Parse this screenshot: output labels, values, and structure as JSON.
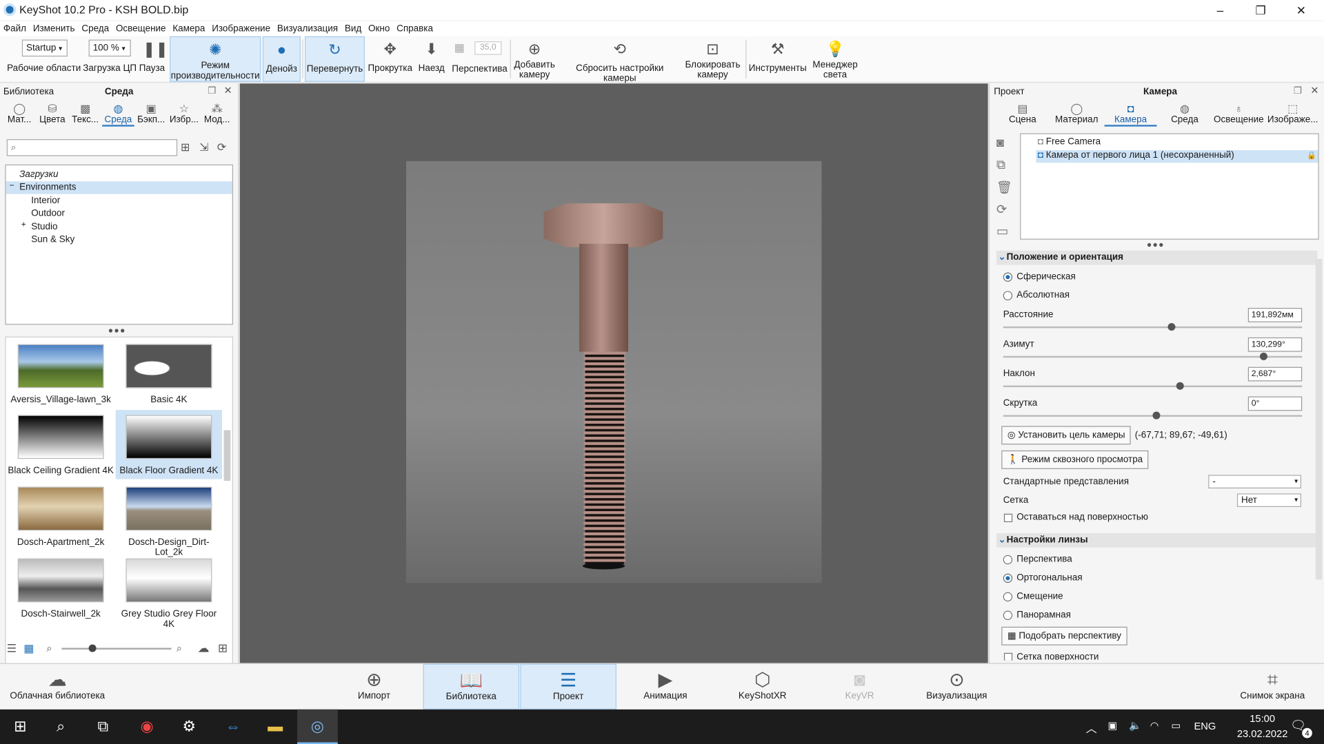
{
  "title": "KeyShot 10.2 Pro  - KSH BOLD.bip",
  "window_controls": {
    "min": "–",
    "max": "❐",
    "close": "✕"
  },
  "menu": [
    "Файл",
    "Изменить",
    "Среда",
    "Освещение",
    "Камера",
    "Изображение",
    "Визуализация",
    "Вид",
    "Окно",
    "Справка"
  ],
  "toolbar": {
    "workspace_value": "Startup",
    "workspace_label": "Рабочие области",
    "cpu_value": "100 %",
    "cpu_label": "Загрузка ЦП",
    "pause": "Пауза",
    "performance": "Режим производительности",
    "denoise": "Денойз",
    "tumble": "Перевернуть",
    "pan": "Прокрутка",
    "dolly": "Наезд",
    "persp_value": "35,0",
    "perspective": "Перспектива",
    "add_camera": "Добавить камеру",
    "reset_camera": "Сбросить настройки камеры",
    "lock_camera": "Блокировать камеру",
    "tools": "Инструменты",
    "light_manager": "Менеджер света"
  },
  "left": {
    "title": "Библиотека",
    "subtitle": "Среда",
    "tabs": [
      "Мат...",
      "Цвета",
      "Текс...",
      "Среда",
      "Бэкп...",
      "Избр...",
      "Мод..."
    ],
    "tree": [
      "Загрузки",
      "Environments",
      "Interior",
      "Outdoor",
      "Studio",
      "Sun & Sky"
    ],
    "thumbs": [
      "Aversis_Village-lawn_3k",
      "Basic 4K",
      "Black Ceiling Gradient 4K",
      "Black Floor Gradient 4K",
      "Dosch-Apartment_2k",
      "Dosch-Design_Dirt-Lot_2k",
      "Dosch-Stairwell_2k",
      "Grey Studio Grey Floor 4K"
    ]
  },
  "right": {
    "title": "Проект",
    "subtitle": "Камера",
    "tabs": [
      "Сцена",
      "Материал",
      "Камера",
      "Среда",
      "Освещение",
      "Изображе..."
    ],
    "cameras": [
      "Free Camera",
      "Камера от первого лица 1 (несохраненный)"
    ],
    "section1": "Положение и ориентация",
    "spherical": "Сферическая",
    "absolute": "Абсолютная",
    "distance_label": "Расстояние",
    "distance": "191,892мм",
    "distance_pos": 0.55,
    "azimuth_label": "Азимут",
    "azimuth": "130,299°",
    "azimuth_pos": 0.86,
    "incl_label": "Наклон",
    "incl": "2,687°",
    "incl_pos": 0.58,
    "twist_label": "Скрутка",
    "twist": "0°",
    "twist_pos": 0.5,
    "set_target": "Установить цель камеры",
    "target_coords": "(-67,71; 89,67; -49,61)",
    "walkthrough": "Режим сквозного просмотра",
    "std_views": "Стандартные представления",
    "std_value": "-",
    "grid": "Сетка",
    "grid_value": "Нет",
    "stay_above": "Оставаться над поверхностью",
    "section2": "Настройки линзы",
    "lens": [
      "Перспектива",
      "Ортогональная",
      "Смещение",
      "Панорамная"
    ],
    "match_persp": "Подобрать перспективу",
    "grid_surface": "Сетка поверхности"
  },
  "bottom": {
    "cloud": "Облачная библиотека",
    "import": "Импорт",
    "library": "Библиотека",
    "project": "Проект",
    "animation": "Анимация",
    "keyshotxr": "KeyShotXR",
    "keyvr": "KeyVR",
    "render": "Визуализация",
    "screenshot": "Снимок экрана"
  },
  "taskbar": {
    "lang": "ENG",
    "time": "15:00",
    "date": "23.02.2022",
    "notif": "4"
  },
  "colors": {
    "accent": "#3b7fc4",
    "viewport": "#5e5e5e"
  }
}
